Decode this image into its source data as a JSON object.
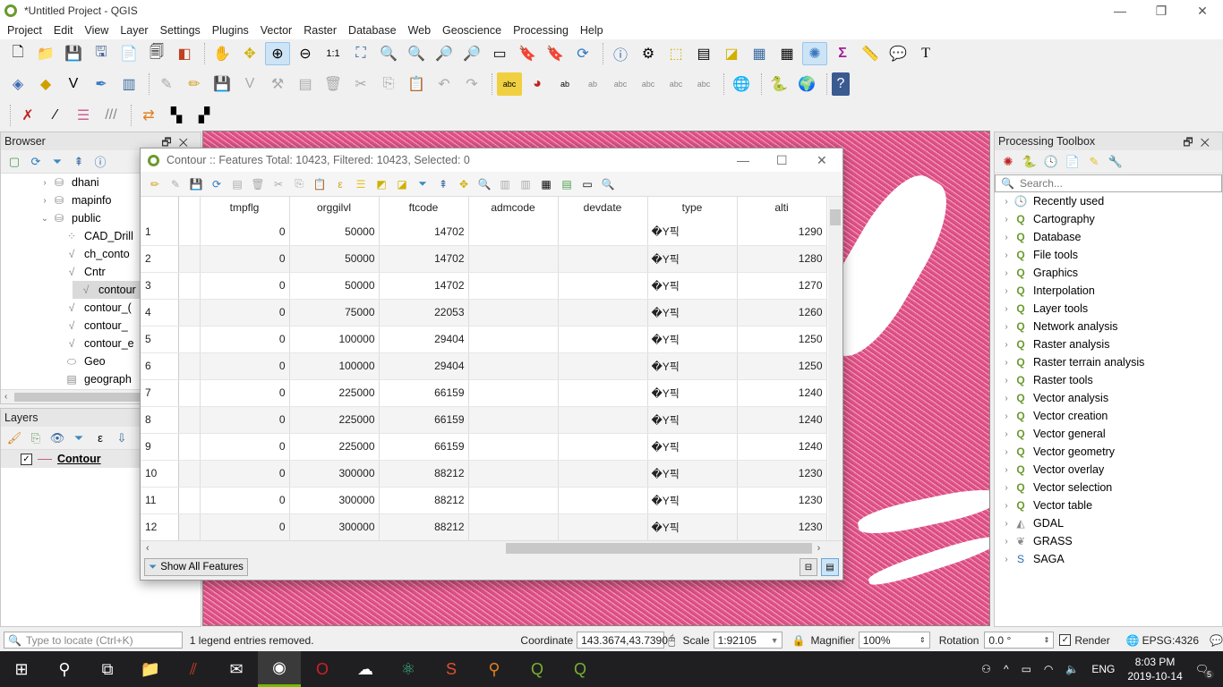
{
  "window": {
    "title": "*Untitled Project - QGIS"
  },
  "menu": [
    "Project",
    "Edit",
    "View",
    "Layer",
    "Settings",
    "Plugins",
    "Vector",
    "Raster",
    "Database",
    "Web",
    "Geoscience",
    "Processing",
    "Help"
  ],
  "browser": {
    "title": "Browser",
    "items": [
      {
        "label": "dhani",
        "icon": "database-icon",
        "expand": "collapsed",
        "indent": 1
      },
      {
        "label": "mapinfo",
        "icon": "database-icon",
        "expand": "collapsed",
        "indent": 1
      },
      {
        "label": "public",
        "icon": "database-icon",
        "expand": "expanded",
        "indent": 1
      },
      {
        "label": "CAD_Drill",
        "icon": "point-layer-icon",
        "expand": "none",
        "indent": 2
      },
      {
        "label": "ch_conto",
        "icon": "line-layer-icon",
        "expand": "none",
        "indent": 2
      },
      {
        "label": "Cntr",
        "icon": "line-layer-icon",
        "expand": "none",
        "indent": 2
      },
      {
        "label": "contour",
        "icon": "line-layer-icon",
        "expand": "none",
        "indent": 2,
        "selected": true
      },
      {
        "label": "contour_(",
        "icon": "line-layer-icon",
        "expand": "none",
        "indent": 2
      },
      {
        "label": "contour_",
        "icon": "line-layer-icon",
        "expand": "none",
        "indent": 2
      },
      {
        "label": "contour_e",
        "icon": "line-layer-icon",
        "expand": "none",
        "indent": 2
      },
      {
        "label": "Geo",
        "icon": "polygon-layer-icon",
        "expand": "none",
        "indent": 2
      },
      {
        "label": "geograph",
        "icon": "table-layer-icon",
        "expand": "none",
        "indent": 2
      }
    ]
  },
  "layers": {
    "title": "Layers",
    "items": [
      {
        "label": "Contour",
        "checked": true,
        "color": "#c06090"
      }
    ]
  },
  "attribute_table": {
    "title": "Contour :: Features Total: 10423, Filtered: 10423, Selected: 0",
    "columns": [
      "",
      "tmpflg",
      "orggilvl",
      "ftcode",
      "admcode",
      "devdate",
      "type",
      "alti"
    ],
    "rows": [
      {
        "n": "1",
        "tmpflg": "0",
        "orggilvl": "50000",
        "ftcode": "14702",
        "admcode": "",
        "devdate": "",
        "type": "�Y픽",
        "alti": "1290"
      },
      {
        "n": "2",
        "tmpflg": "0",
        "orggilvl": "50000",
        "ftcode": "14702",
        "admcode": "",
        "devdate": "",
        "type": "�Y픽",
        "alti": "1280"
      },
      {
        "n": "3",
        "tmpflg": "0",
        "orggilvl": "50000",
        "ftcode": "14702",
        "admcode": "",
        "devdate": "",
        "type": "�Y픽",
        "alti": "1270"
      },
      {
        "n": "4",
        "tmpflg": "0",
        "orggilvl": "75000",
        "ftcode": "22053",
        "admcode": "",
        "devdate": "",
        "type": "�Y픽",
        "alti": "1260"
      },
      {
        "n": "5",
        "tmpflg": "0",
        "orggilvl": "100000",
        "ftcode": "29404",
        "admcode": "",
        "devdate": "",
        "type": "�Y픽",
        "alti": "1250"
      },
      {
        "n": "6",
        "tmpflg": "0",
        "orggilvl": "100000",
        "ftcode": "29404",
        "admcode": "",
        "devdate": "",
        "type": "�Y픽",
        "alti": "1250"
      },
      {
        "n": "7",
        "tmpflg": "0",
        "orggilvl": "225000",
        "ftcode": "66159",
        "admcode": "",
        "devdate": "",
        "type": "�Y픽",
        "alti": "1240"
      },
      {
        "n": "8",
        "tmpflg": "0",
        "orggilvl": "225000",
        "ftcode": "66159",
        "admcode": "",
        "devdate": "",
        "type": "�Y픽",
        "alti": "1240"
      },
      {
        "n": "9",
        "tmpflg": "0",
        "orggilvl": "225000",
        "ftcode": "66159",
        "admcode": "",
        "devdate": "",
        "type": "�Y픽",
        "alti": "1240"
      },
      {
        "n": "10",
        "tmpflg": "0",
        "orggilvl": "300000",
        "ftcode": "88212",
        "admcode": "",
        "devdate": "",
        "type": "�Y픽",
        "alti": "1230"
      },
      {
        "n": "11",
        "tmpflg": "0",
        "orggilvl": "300000",
        "ftcode": "88212",
        "admcode": "",
        "devdate": "",
        "type": "�Y픽",
        "alti": "1230"
      },
      {
        "n": "12",
        "tmpflg": "0",
        "orggilvl": "300000",
        "ftcode": "88212",
        "admcode": "",
        "devdate": "",
        "type": "�Y픽",
        "alti": "1230"
      }
    ],
    "show_all_label": "Show All Features"
  },
  "processing": {
    "title": "Processing Toolbox",
    "search_placeholder": "Search...",
    "items": [
      {
        "label": "Recently used",
        "icon": "clock-icon"
      },
      {
        "label": "Cartography",
        "icon": "qgis-icon"
      },
      {
        "label": "Database",
        "icon": "qgis-icon"
      },
      {
        "label": "File tools",
        "icon": "qgis-icon"
      },
      {
        "label": "Graphics",
        "icon": "qgis-icon"
      },
      {
        "label": "Interpolation",
        "icon": "qgis-icon"
      },
      {
        "label": "Layer tools",
        "icon": "qgis-icon"
      },
      {
        "label": "Network analysis",
        "icon": "qgis-icon"
      },
      {
        "label": "Raster analysis",
        "icon": "qgis-icon"
      },
      {
        "label": "Raster terrain analysis",
        "icon": "qgis-icon"
      },
      {
        "label": "Raster tools",
        "icon": "qgis-icon"
      },
      {
        "label": "Vector analysis",
        "icon": "qgis-icon"
      },
      {
        "label": "Vector creation",
        "icon": "qgis-icon"
      },
      {
        "label": "Vector general",
        "icon": "qgis-icon"
      },
      {
        "label": "Vector geometry",
        "icon": "qgis-icon"
      },
      {
        "label": "Vector overlay",
        "icon": "qgis-icon"
      },
      {
        "label": "Vector selection",
        "icon": "qgis-icon"
      },
      {
        "label": "Vector table",
        "icon": "qgis-icon"
      },
      {
        "label": "GDAL",
        "icon": "gdal-icon"
      },
      {
        "label": "GRASS",
        "icon": "grass-icon"
      },
      {
        "label": "SAGA",
        "icon": "saga-icon"
      }
    ]
  },
  "status": {
    "locate_placeholder": "Type to locate (Ctrl+K)",
    "message": "1 legend entries removed.",
    "coordinate_label": "Coordinate",
    "coordinate": "143.3674,43.7390",
    "scale_label": "Scale",
    "scale": "1:92105",
    "magnifier_label": "Magnifier",
    "magnifier": "100%",
    "rotation_label": "Rotation",
    "rotation": "0.0 °",
    "render_label": "Render",
    "render_checked": true,
    "crs": "EPSG:4326"
  },
  "taskbar": {
    "time": "8:03 PM",
    "date": "2019-10-14",
    "lang": "ENG",
    "notifications": "5"
  },
  "colors": {
    "map_contour": "#e0578a",
    "qgis_green": "#6a9a2e"
  }
}
